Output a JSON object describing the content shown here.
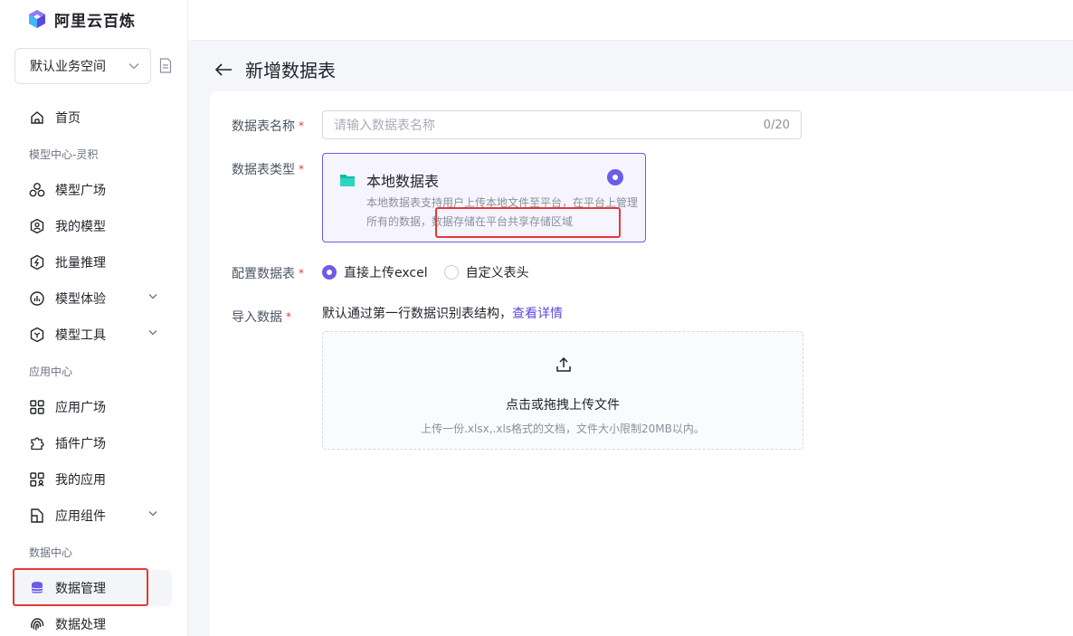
{
  "app": {
    "brand": "阿里云百炼"
  },
  "workspace": {
    "label": "默认业务空间"
  },
  "sidebar": {
    "items": [
      {
        "label": "首页"
      },
      {
        "section": "模型中心-灵积"
      },
      {
        "label": "模型广场"
      },
      {
        "label": "我的模型"
      },
      {
        "label": "批量推理"
      },
      {
        "label": "模型体验"
      },
      {
        "label": "模型工具"
      },
      {
        "section": "应用中心"
      },
      {
        "label": "应用广场"
      },
      {
        "label": "插件广场"
      },
      {
        "label": "我的应用"
      },
      {
        "label": "应用组件"
      },
      {
        "section": "数据中心"
      },
      {
        "label": "数据管理"
      },
      {
        "label": "数据处理"
      }
    ]
  },
  "page": {
    "title": "新增数据表"
  },
  "form": {
    "name_label": "数据表名称",
    "name_placeholder": "请输入数据表名称",
    "name_count": "0/20",
    "type_label": "数据表类型",
    "type_card": {
      "title": "本地数据表",
      "desc": "本地数据表支持用户上传本地文件至平台，在平台上管理所有的数据，数据存储在平台共享存储区域"
    },
    "config_label": "配置数据表",
    "config_options": [
      "直接上传excel",
      "自定义表头"
    ],
    "import_label": "导入数据",
    "import_tip": "默认通过第一行数据识别表结构，",
    "import_link": "查看详情",
    "upload_main": "点击或拖拽上传文件",
    "upload_sub": "上传一份.xlsx,.xls格式的文档，文件大小限制20MB以内。"
  },
  "required_mark": "*",
  "colors": {
    "accent": "#6c5ce7",
    "highlight": "#e53935"
  }
}
